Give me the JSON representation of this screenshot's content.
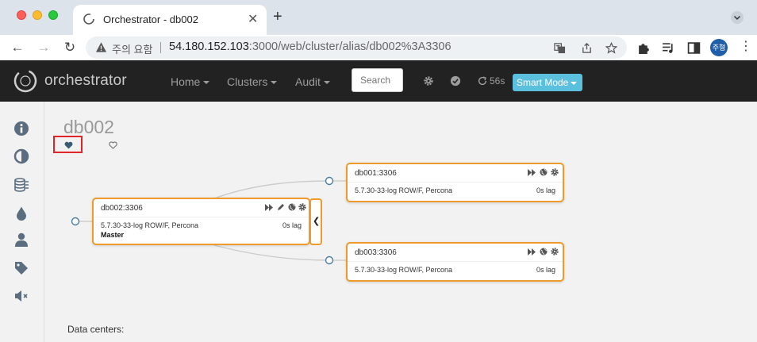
{
  "browser": {
    "tab_title": "Orchestrator - db002",
    "tab_close": "✕",
    "new_tab": "+",
    "security_warning": "주의 요함",
    "url_host": "54.180.152.103",
    "url_path": ":3000/web/cluster/alias/db002%3A3306",
    "profile_initials": "주형",
    "menu_glyph": "⋮",
    "back_glyph": "←",
    "forward_glyph": "→",
    "reload_glyph": "↻"
  },
  "navbar": {
    "brand": "orchestrator",
    "menu": [
      {
        "label": "Home"
      },
      {
        "label": "Clusters"
      },
      {
        "label": "Audit"
      }
    ],
    "search_placeholder": "Search",
    "refresh_countdown": "56s",
    "mode_button": "Smart Mode"
  },
  "sidebar": {
    "items": [
      "info-icon",
      "contrast-icon",
      "database-icon",
      "drop-icon",
      "user-icon",
      "tag-icon",
      "mute-icon"
    ]
  },
  "cluster": {
    "title": "db002",
    "favorite_highlight_color": "#e0252a"
  },
  "nodes": [
    {
      "name": "db002:3306",
      "version": "5.7.30-33-log ROW/F, Percona",
      "lag": "0s lag",
      "role": "Master"
    },
    {
      "name": "db001:3306",
      "version": "5.7.30-33-log ROW/F, Percona",
      "lag": "0s lag",
      "role": ""
    },
    {
      "name": "db003:3306",
      "version": "5.7.30-33-log ROW/F, Percona",
      "lag": "0s lag",
      "role": ""
    }
  ],
  "collapse_glyph": "❮",
  "footer": {
    "data_centers_label": "Data centers:"
  },
  "colors": {
    "node_border": "#ee9a2c",
    "smart_mode_bg": "#5bc0de",
    "navbar_bg": "#222222",
    "sidebar_icon": "#5a6e80"
  }
}
